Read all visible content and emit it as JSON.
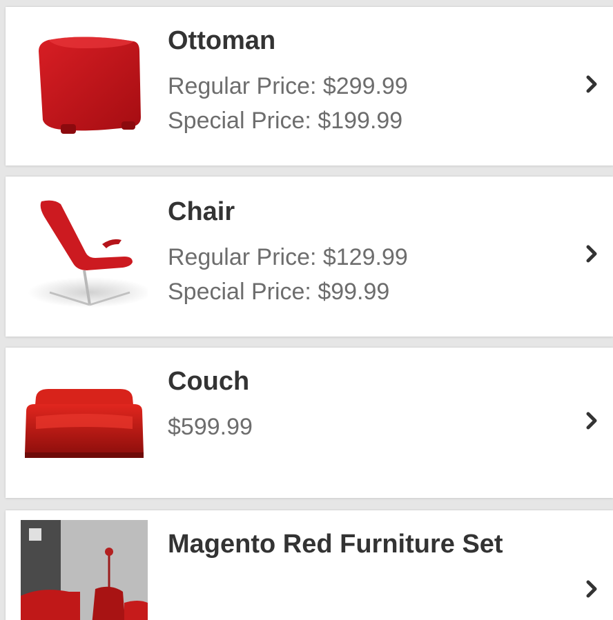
{
  "products": [
    {
      "name": "Ottoman",
      "prices": [
        "Regular Price: $299.99",
        "Special Price: $199.99"
      ],
      "thumbnail_icon": "ottoman-image"
    },
    {
      "name": "Chair",
      "prices": [
        "Regular Price: $129.99",
        "Special Price: $99.99"
      ],
      "thumbnail_icon": "chair-image"
    },
    {
      "name": "Couch",
      "prices": [
        "$599.99"
      ],
      "thumbnail_icon": "couch-image"
    },
    {
      "name": "Magento Red Furniture Set",
      "prices": [],
      "thumbnail_icon": "furniture-set-image"
    }
  ],
  "colors": {
    "product_red": "#c8161d",
    "title_text": "#333333",
    "price_text": "#6d6d6d",
    "chevron": "#333333"
  },
  "row_action_icon": "chevron-right-icon"
}
